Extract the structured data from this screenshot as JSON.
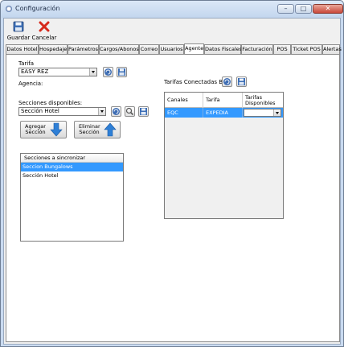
{
  "window": {
    "title": "Configuración"
  },
  "toolbar": {
    "save_label": "Guardar",
    "cancel_label": "Cancelar"
  },
  "tabs": [
    {
      "label": "Datos Hotel"
    },
    {
      "label": "Hospedaje"
    },
    {
      "label": "Parámetros"
    },
    {
      "label": "Cargos/Abonos"
    },
    {
      "label": "Correo"
    },
    {
      "label": "Usuarios"
    },
    {
      "label": "Agente"
    },
    {
      "label": "Datos Fiscales"
    },
    {
      "label": "Facturación"
    },
    {
      "label": "POS"
    },
    {
      "label": "Ticket POS"
    },
    {
      "label": "Alertas"
    }
  ],
  "agente": {
    "tarifa_label": "Tarifa",
    "tarifa_value": "EASY REZ",
    "agencia_label": "Agencia:",
    "secciones_label": "Secciones disponibles:",
    "secciones_value": "Sección Hotel",
    "agregar_label": "Agregar Sección",
    "eliminar_label": "Eliminar Sección",
    "sync_header": "Secciones a sincronizar",
    "sync_items": [
      "Seccion Bungalows",
      "Sección Hotel"
    ],
    "tarifas_conectadas_label": "Tarifas Conectadas BE",
    "grid_headers": {
      "canales": "Canales",
      "tarifa": "Tarifa",
      "disponibles": "Tarifas Disponibles"
    },
    "grid_rows": [
      {
        "canal": "EQC",
        "tarifa": "EXPEDIA",
        "disponible": ""
      }
    ]
  }
}
